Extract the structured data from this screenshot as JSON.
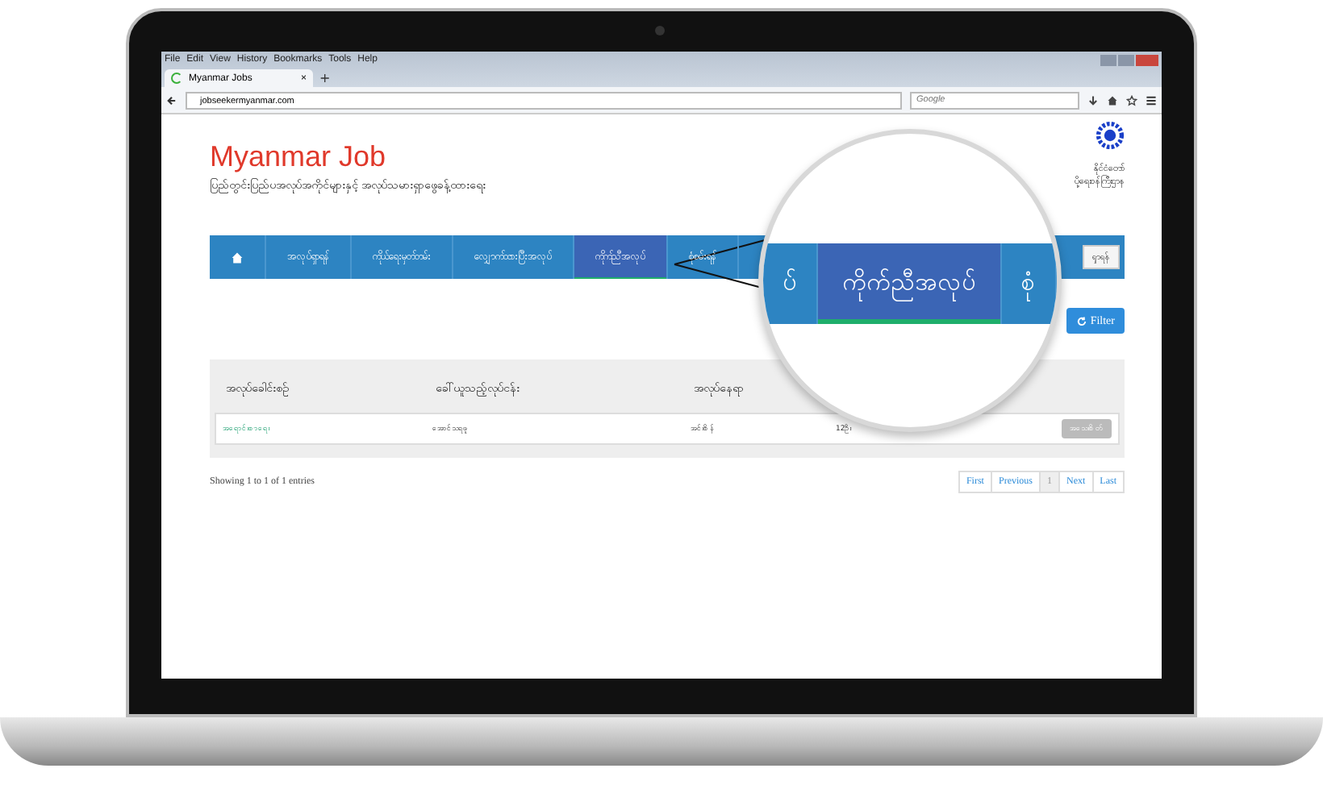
{
  "browser": {
    "menu": [
      "File",
      "Edit",
      "View",
      "History",
      "Bookmarks",
      "Tools",
      "Help"
    ],
    "tab": {
      "title": "Myanmar Jobs",
      "close": "×"
    },
    "new_tab": "+",
    "url": "jobseekermyanmar.com",
    "search": {
      "placeholder": "Google"
    }
  },
  "page": {
    "title": "Myanmar Job",
    "subtitle": "ပြည်တွင်းပြည်ပအလုပ်အကိုင်များနှင့် အလုပ်သမားရှာဖွေခန့်ထားရေး",
    "ministry_lines": [
      "နိုင်ငံတော်",
      "ပို့ရေးဝန်ကြီးဌာန"
    ],
    "nav": [
      {
        "kind": "home",
        "selected": false
      },
      {
        "kind": "text",
        "label": "အလုပ်ရှာရန်",
        "selected": false
      },
      {
        "kind": "text",
        "label": "ကိုယ်ရေးမှတ်တမ်း",
        "selected": false
      },
      {
        "kind": "text",
        "label": "လျှောက်ထားပြီးအလုပ်",
        "selected": false
      },
      {
        "kind": "text",
        "label": "ကိုက်ညီအလုပ်",
        "selected": true
      },
      {
        "kind": "text",
        "label": "စုံစမ်းရန်",
        "selected": false
      }
    ],
    "search_button": "ရှာရန်",
    "filter_button": "Filter",
    "table": {
      "columns": [
        "အလုပ်ခေါင်းစဉ်",
        "ခေါ်ယူသည့်လုပ်ငန်း",
        "အလုပ်နေရာ"
      ],
      "rows": [
        {
          "cells": [
            "အရောင်းစာရေး",
            "အောင်သရဖူ",
            "အင်းစိန်",
            "12ဦး"
          ],
          "action": "အသေးစိတ်"
        }
      ]
    },
    "info": "Showing 1 to 1 of 1 entries",
    "pagination": [
      {
        "label": "First",
        "selected": false
      },
      {
        "label": "Previous",
        "selected": false
      },
      {
        "label": "1",
        "selected": true
      },
      {
        "label": "Next",
        "selected": false
      },
      {
        "label": "Last",
        "selected": false
      }
    ],
    "magnifier": {
      "items": [
        {
          "label": "ပ်",
          "selected": false
        },
        {
          "label": "ကိုက်ညီအလုပ်",
          "selected": true
        },
        {
          "label": "စုံ",
          "selected": false
        }
      ]
    }
  }
}
